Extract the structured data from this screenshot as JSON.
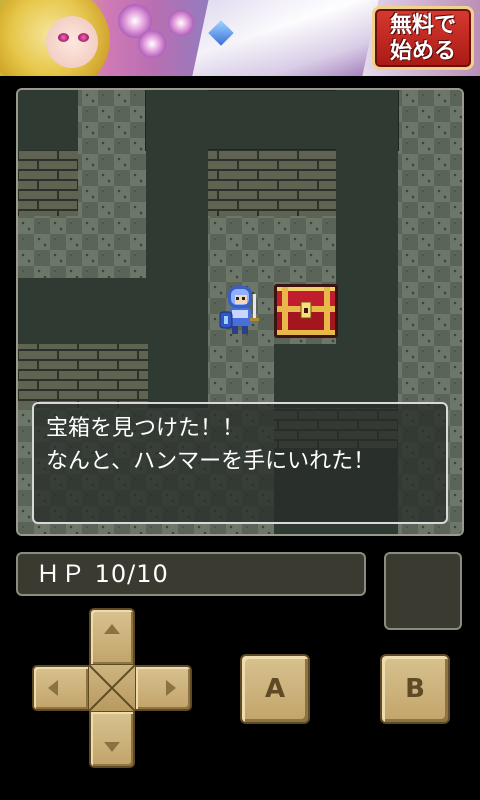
{
  "ad": {
    "button_line1": "無料で",
    "button_line2": "始める"
  },
  "dialog": {
    "line1": "宝箱を見つけた！！",
    "line2": "なんと、ハンマーを手にいれた！"
  },
  "status": {
    "hp_text": "ＨＰ 10/10",
    "hp_current": 10,
    "hp_max": 10
  },
  "controls": {
    "a_label": "A",
    "b_label": "B"
  },
  "colors": {
    "floor": "#2f3a33",
    "checker_light": "#6c7769",
    "checker_dark": "#5a6458",
    "brick": "#5f6452",
    "chest": "#c21d2e",
    "chest_trim": "#e8b84a",
    "knight": "#4a6fd6"
  }
}
